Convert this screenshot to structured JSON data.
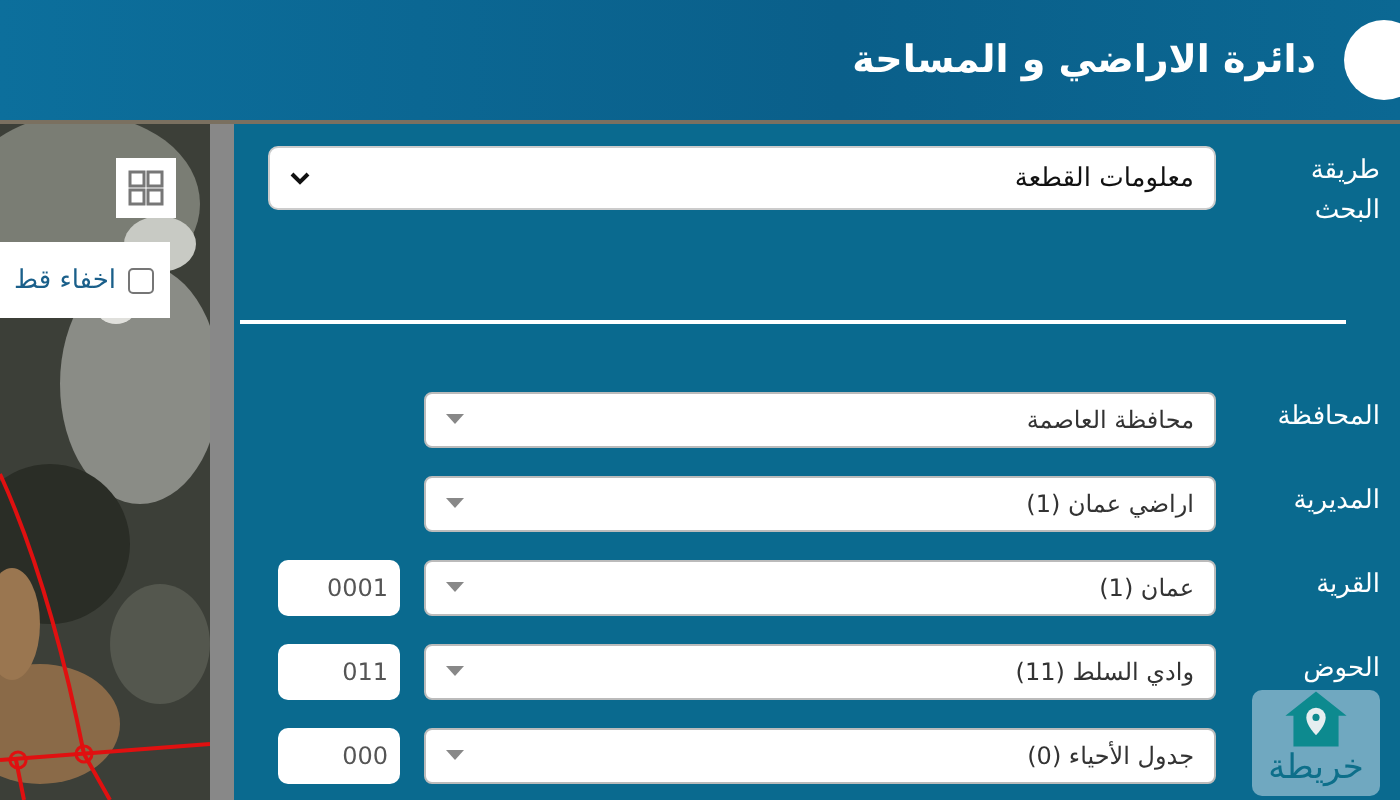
{
  "header": {
    "title": "دائرة الاراضي و المساحة"
  },
  "map": {
    "hide_toggle": {
      "label": "اخفاء قط",
      "checked": false
    },
    "map_button": {
      "label": "خريطة"
    }
  },
  "search_method": {
    "label": "طريقة البحث",
    "value": "معلومات القطعة"
  },
  "fields": [
    {
      "label": "المحافظة",
      "value": "محافظة العاصمة"
    },
    {
      "label": "المديرية",
      "value": "اراضي عمان (1)"
    },
    {
      "label": "القرية",
      "value": "عمان (1)",
      "code": "0001"
    },
    {
      "label": "الحوض",
      "value": "وادي السلط (11)",
      "code": "011"
    },
    {
      "value": "جدول الأحياء (0)",
      "code": "000"
    }
  ]
}
